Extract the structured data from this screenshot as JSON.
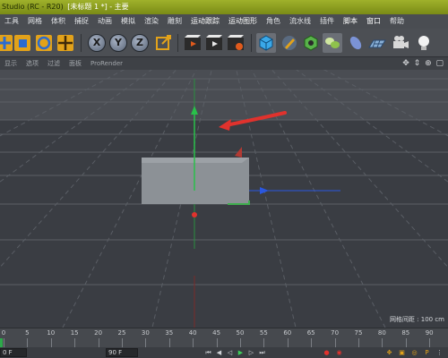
{
  "title": {
    "app": "Studio (RC - R20)",
    "doc": "[未标题 1 *] - 主要"
  },
  "menu": [
    "工具",
    "网格",
    "体积",
    "捕捉",
    "动画",
    "模拟",
    "渲染",
    "雕刻",
    "运动跟踪",
    "运动图形",
    "角色",
    "流水线",
    "插件",
    "脚本",
    "窗口",
    "帮助"
  ],
  "toolbar": {
    "axes": [
      "X",
      "Y",
      "Z"
    ]
  },
  "viewport_menu": [
    "显示",
    "选项",
    "过滤",
    "面板",
    "ProRender"
  ],
  "viewport_nav": "✥ ⇕ ⊕ ▢",
  "grid_spacing": "网格间距 : 100 cm",
  "timeline": {
    "ticks": [
      "0",
      "5",
      "10",
      "15",
      "20",
      "25",
      "30",
      "35",
      "40",
      "45",
      "50",
      "55",
      "60",
      "65",
      "70",
      "75",
      "80",
      "85",
      "90"
    ]
  },
  "transport": {
    "frame_left": "0 F",
    "frame_right": "90 F"
  },
  "colors": {
    "x_axis": "#e0322d",
    "y_axis": "#29c04a",
    "z_axis": "#2a57e0",
    "title_bar": "#8a9c1f"
  }
}
